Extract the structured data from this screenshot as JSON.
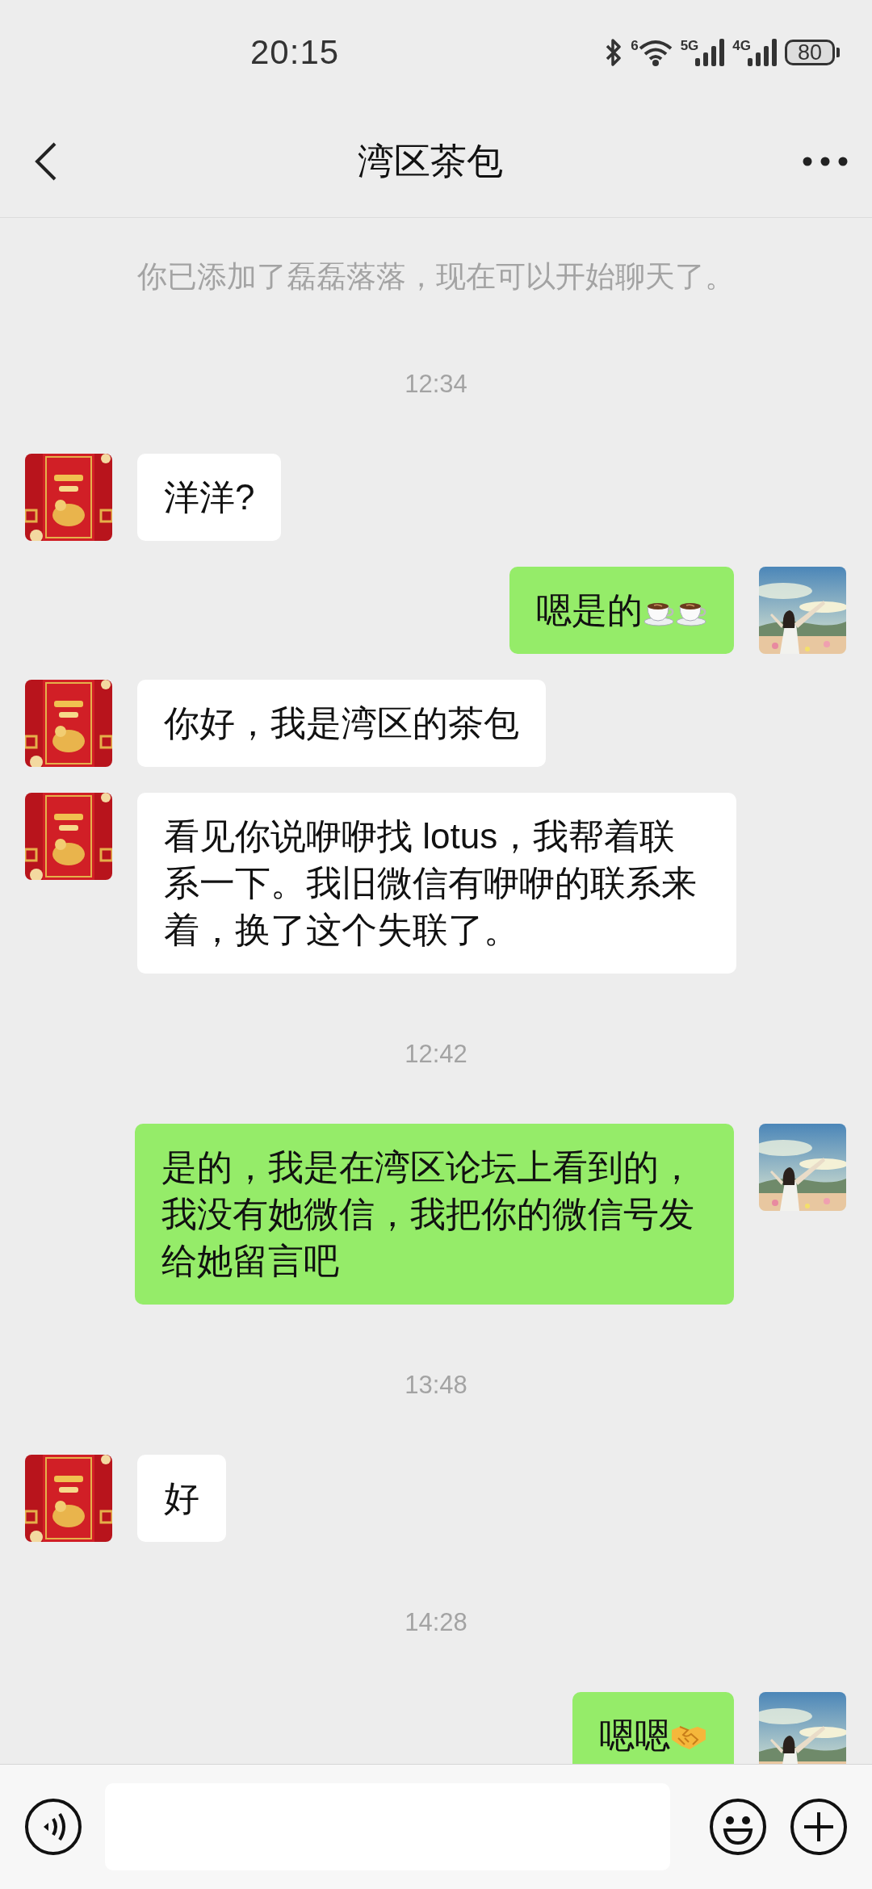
{
  "status_bar": {
    "time": "20:15",
    "wifi_label": "6",
    "networks": [
      "5G",
      "4G"
    ],
    "battery": "80"
  },
  "header": {
    "title": "湾区茶包"
  },
  "messages": [
    {
      "kind": "system",
      "text": "你已添加了磊磊落落，现在可以开始聊天了。"
    },
    {
      "kind": "time",
      "text": "12:34"
    },
    {
      "kind": "received",
      "text": "洋洋?"
    },
    {
      "kind": "sent",
      "text": "嗯是的",
      "emoji": [
        {
          "kind": "coffee"
        },
        {
          "kind": "coffee"
        }
      ]
    },
    {
      "kind": "received",
      "text": "你好，我是湾区的茶包"
    },
    {
      "kind": "received",
      "text": "看见你说咿咿找 lotus，我帮着联系一下。我旧微信有咿咿的联系来着，换了这个失联了。"
    },
    {
      "kind": "time",
      "text": "12:42"
    },
    {
      "kind": "sent",
      "text": "是的，我是在湾区论坛上看到的，我没有她微信，我把你的微信号发给她留言吧"
    },
    {
      "kind": "time",
      "text": "13:48"
    },
    {
      "kind": "received",
      "text": "好"
    },
    {
      "kind": "time",
      "text": "14:28"
    },
    {
      "kind": "sent",
      "text": "嗯嗯",
      "emoji": [
        {
          "kind": "handshake"
        }
      ]
    }
  ]
}
